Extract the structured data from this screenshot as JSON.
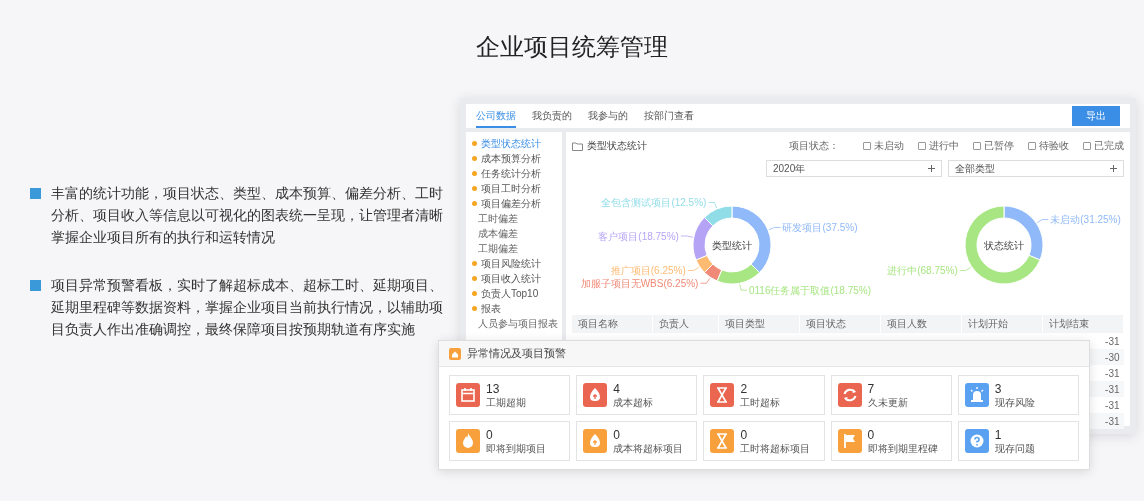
{
  "title": "企业项目统筹管理",
  "features": [
    {
      "text": "丰富的统计功能，项目状态、类型、成本预算、偏差分析、工时分析、项目收入等信息以可视化的图表统一呈现，让管理者清晰掌握企业项目所有的执行和运转情况"
    },
    {
      "text": "项目异常预警看板，实时了解超标成本、超标工时、延期项目、延期里程碑等数据资料，掌握企业项目当前执行情况，以辅助项目负责人作出准确调控，最终保障项目按预期轨道有序实施"
    }
  ],
  "dashboard": {
    "tabs": [
      {
        "label": "公司数据",
        "selected": true
      },
      {
        "label": "我负责的",
        "selected": false
      },
      {
        "label": "我参与的",
        "selected": false
      },
      {
        "label": "按部门查看",
        "selected": false
      }
    ],
    "export_button": "导出",
    "sidebar": {
      "items": [
        {
          "label": "类型状态统计",
          "selected": true
        },
        {
          "label": "成本预算分析",
          "selected": false
        },
        {
          "label": "任务统计分析",
          "selected": false
        },
        {
          "label": "项目工时分析",
          "selected": false
        },
        {
          "label": "项目偏差分析",
          "selected": false,
          "children": [
            {
              "label": "工时偏差",
              "selected": false
            },
            {
              "label": "成本偏差",
              "selected": false
            },
            {
              "label": "工期偏差",
              "selected": false
            }
          ]
        },
        {
          "label": "项目风险统计",
          "selected": false
        },
        {
          "label": "项目收入统计",
          "selected": false
        },
        {
          "label": "负责人Top10",
          "selected": false
        },
        {
          "label": "报表",
          "selected": false,
          "children": [
            {
              "label": "人员参与项目报表",
              "selected": false
            }
          ]
        }
      ]
    },
    "panel_title": "类型状态统计",
    "status_filter": {
      "label": "项目状态：",
      "options": [
        {
          "label": "未启动",
          "checked": false
        },
        {
          "label": "进行中",
          "checked": false
        },
        {
          "label": "已暂停",
          "checked": false
        },
        {
          "label": "待验收",
          "checked": false
        },
        {
          "label": "已完成",
          "checked": false
        }
      ]
    },
    "year_select": {
      "value": "2020年"
    },
    "type_select": {
      "value": "全部类型"
    },
    "charts": [
      {
        "chart_data": {
          "type": "donut",
          "title": "类型统计",
          "categories": [
            "研发项目(37.5%)",
            "0116任务属于取值(18.75%)",
            "加服子项目无WBS(6.25%)",
            "推广项目(6.25%)",
            "客户项目(18.75%)",
            "全包含测试项目(12.5%)"
          ],
          "values": [
            37.5,
            18.75,
            6.25,
            6.25,
            18.75,
            12.5
          ],
          "colors": [
            "#8fb9f8",
            "#a8e683",
            "#f08a78",
            "#fdbb72",
            "#b5a4f6",
            "#90dde8"
          ]
        }
      },
      {
        "chart_data": {
          "type": "donut",
          "title": "状态统计",
          "categories": [
            "未启动(31.25%)",
            "进行中(68.75%)"
          ],
          "values": [
            31.25,
            68.75
          ],
          "colors": [
            "#8fb9f8",
            "#a8e683"
          ]
        }
      }
    ],
    "table": {
      "columns": [
        "项目名称",
        "负责人",
        "项目类型",
        "项目状态",
        "项目人数",
        "计划开始",
        "计划结束"
      ],
      "rows": [
        {
          "column_7": "-31"
        },
        {
          "column_7": "-30"
        },
        {
          "column_7": "-31"
        },
        {
          "column_7": "-31"
        },
        {
          "column_7": "-31"
        },
        {
          "column_7": "-31"
        }
      ]
    }
  },
  "alerts": {
    "title": "异常情况及项目预警",
    "tiles": [
      {
        "count": "13",
        "label": "工期超期",
        "color": "#ea6651"
      },
      {
        "count": "4",
        "label": "成本超标",
        "color": "#ea6651"
      },
      {
        "count": "2",
        "label": "工时超标",
        "color": "#ea6651"
      },
      {
        "count": "7",
        "label": "久未更新",
        "color": "#ea6651"
      },
      {
        "count": "3",
        "label": "现存风险",
        "color": "#5aa1f2"
      },
      {
        "count": "0",
        "label": "即将到期项目",
        "color": "#f7a03c"
      },
      {
        "count": "0",
        "label": "成本将超标项目",
        "color": "#f7a03c"
      },
      {
        "count": "0",
        "label": "工时将超标项目",
        "color": "#f7a03c"
      },
      {
        "count": "0",
        "label": "即将到期里程碑",
        "color": "#f7a03c"
      },
      {
        "count": "1",
        "label": "现存问题",
        "color": "#5aa1f2"
      }
    ]
  }
}
